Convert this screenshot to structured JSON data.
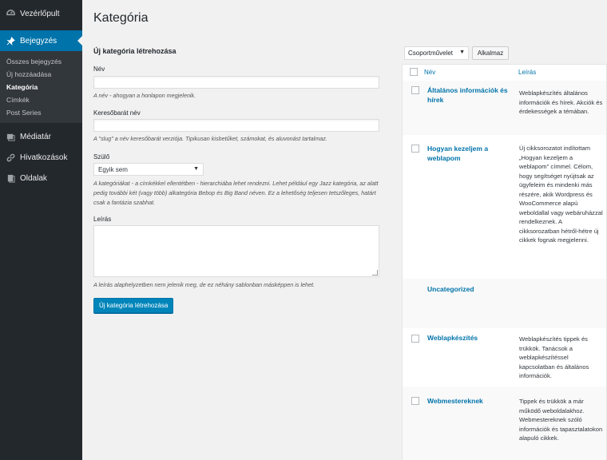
{
  "sidebar": {
    "dashboard": "Vezérlőpult",
    "posts": "Bejegyzés",
    "submenu": [
      "Összes bejegyzés",
      "Új hozzáadása",
      "Kategória",
      "Címkék",
      "Post Series"
    ],
    "media": "Médiatár",
    "links": "Hivatkozások",
    "pages": "Oldalak"
  },
  "page": {
    "title": "Kategória"
  },
  "form": {
    "title": "Új kategória létrehozása",
    "name_label": "Név",
    "name_desc": "A név - ahogyan a honlapon megjelenik.",
    "slug_label": "Keresőbarát név",
    "slug_desc": "A \"slug\" a név keresőbarát verziója. Tipikusan kisbetűket, számokat, és aluvonást tartalmaz.",
    "parent_label": "Szülő",
    "parent_value": "Egyik sem",
    "parent_desc": "A kategóriákat - a címkékkel ellentétben - hierarchiába lehet rendezni. Lehet például egy Jazz kategória, az alatt pedig további két (vagy több) alkategória Bebop és Big Band néven. Ez a lehetőség teljesen tetszőleges, határt csak a fantázia szabhat.",
    "desc_label": "Leírás",
    "desc_desc": "A leírás alaphelyzetben nem jelenik meg, de ez néhány sablonban másképpen is lehet.",
    "submit": "Új kategória létrehozása"
  },
  "table": {
    "bulk_action": "Csoportművelet",
    "apply": "Alkalmaz",
    "col_name": "Név",
    "col_desc": "Leírás",
    "rows": [
      {
        "name": "Általános információk és hírek",
        "desc": "Weblapkészítés általános információk és hírek. Akciók és érdekességek a témában."
      },
      {
        "name": "Hogyan kezeljem a weblapom",
        "desc": "Új cikksorozatot indítottam „Hogyan kezeljem a weblapom\" címmel. Célom, hogy segítséget nyújtsak az ügyfeleim és mindenki más részére, akik Wordpress és WooCommerce alapú weboldallal vagy webáruházzal rendelkeznek. A cikksorozatban hétről-hétre új cikkek fognak megjelenni."
      },
      {
        "name": "Uncategorized",
        "desc": ""
      },
      {
        "name": "Weblapkészítés",
        "desc": "Weblapkészítés tippek és trükkök. Tanácsok a weblapkészítéssel kapcsolatban és általános információk."
      },
      {
        "name": "Webmestereknek",
        "desc": "Tippek és trükkök a már működő weboldalakhoz. Webmestereknek szóló információk és tapasztalatokon alapuló cikkek."
      }
    ]
  }
}
